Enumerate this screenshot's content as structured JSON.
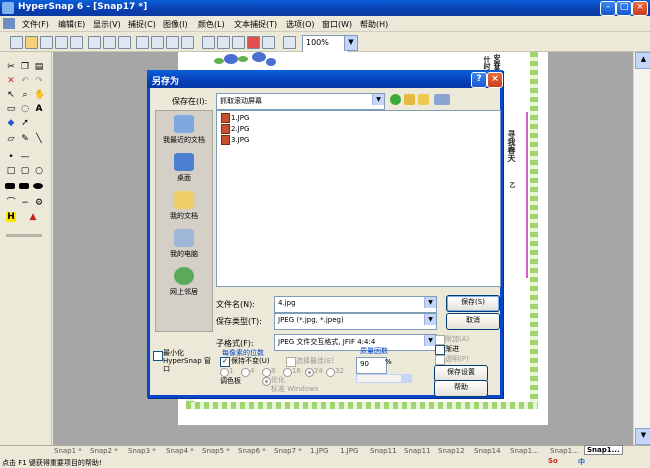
{
  "app": {
    "title": "HyperSnap 6 - [Snap17 *]"
  },
  "menu": [
    "文件(F)",
    "编辑(E)",
    "显示(V)",
    "捕捉(C)",
    "图像(I)",
    "颜色(L)",
    "文本捕捉(T)",
    "选项(O)",
    "窗口(W)",
    "帮助(H)"
  ],
  "toolbar": {
    "zoom": "100%"
  },
  "poem": {
    "col1": "安春春天",
    "col2": "什时",
    "col3": "寻我春天",
    "col4": "乙"
  },
  "tabs": [
    "Snap1 *",
    "Snap2 *",
    "Snap3 *",
    "Snap4 *",
    "Snap5 *",
    "Snap6 *",
    "Snap7 *",
    "1.JPG",
    "1.JPG",
    "Snap11",
    "Snap11",
    "Snap12",
    "Snap14",
    "Snap1...",
    "Snap1...",
    "Snap1..."
  ],
  "status": "点击 F1 键获得重要项目的帮助!",
  "tray": {
    "label": "So",
    "sub": "中"
  },
  "dialog": {
    "title": "另存为",
    "save_in_label": "保存在(I):",
    "save_in_value": "抓取滚动屏幕",
    "places": [
      "我最近的文档",
      "桌面",
      "我的文档",
      "我的电脑",
      "网上邻居"
    ],
    "files": [
      "1.JPG",
      "2.JPG",
      "3.JPG"
    ],
    "filename_label": "文件名(N):",
    "filename_value": "4.jpg",
    "filetype_label": "保存类型(T):",
    "filetype_value": "JPEG (*.jpg, *.jpeg)",
    "subformat_label": "子格式(F):",
    "subformat_value": "JPEG 文件交互格式, JFIF 4:4:4",
    "save_button": "保存(S)",
    "cancel_button": "取消",
    "minimize_label": "最小化 HyperSnap 窗口",
    "bits_label": "每像素的位数",
    "keep_label": "保持不变(U)",
    "best_label": "选择最佳(E)",
    "bit_options": [
      "1",
      "4",
      "8",
      "16",
      "24",
      "32"
    ],
    "palette_label": "调色板",
    "optimize_label": "优化",
    "windows_label": "标准 Windows",
    "quality_label": "质量因数",
    "quality_value": "90",
    "quality_unit": "%",
    "append_label": "附加(A)",
    "progressive_label": "渐进",
    "transparent_label": "透明(P)",
    "save_settings_button": "保存设置",
    "help_button": "帮助"
  }
}
